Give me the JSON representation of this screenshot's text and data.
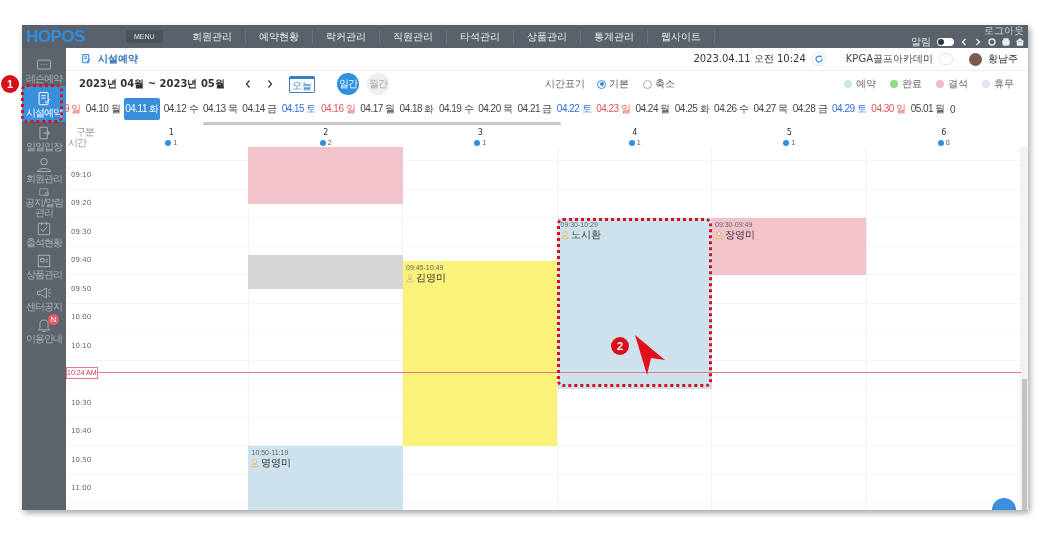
{
  "topbar": {
    "logo": "HOPOS",
    "menu_button": "MENU",
    "nav": [
      "회원관리",
      "예약현황",
      "락커관리",
      "직원관리",
      "타석관리",
      "상품관리",
      "통계관리",
      "웹사이트"
    ],
    "logout": "로그아웃",
    "alarm": {
      "label": "알림",
      "on": false
    }
  },
  "sidebar": {
    "items": [
      {
        "label": "레슨예약",
        "selected": false
      },
      {
        "label": "시설예약",
        "selected": true
      },
      {
        "label": "일일입장",
        "selected": false
      },
      {
        "label": "회원관리",
        "selected": false
      },
      {
        "label": "공지/알림관리",
        "selected": false
      },
      {
        "label": "출석현황",
        "selected": false
      },
      {
        "label": "상품관리",
        "selected": false
      },
      {
        "label": "센터공지",
        "selected": false
      },
      {
        "label": "이용안내",
        "selected": false,
        "badge": "N"
      }
    ]
  },
  "header": {
    "title": "시설예약",
    "datetime": "2023.04.11 오전 10:24",
    "center": "KPGA골프아카데미",
    "user": "황남주"
  },
  "toolbar": {
    "range": "2023년 04월 ~ 2023년 05월",
    "today": "오늘",
    "views": [
      {
        "label": "일간",
        "selected": true
      },
      {
        "label": "월간",
        "selected": false
      }
    ],
    "time_display": {
      "label": "시간표기",
      "options": [
        {
          "label": "기본",
          "selected": true
        },
        {
          "label": "축소",
          "selected": false
        }
      ]
    },
    "legend": [
      {
        "label": "예약",
        "color": "#cfe4ef"
      },
      {
        "label": "완료",
        "color": "#93d98c"
      },
      {
        "label": "결석",
        "color": "#f3b9c5"
      },
      {
        "label": "휴무",
        "color": "#e6e3f3"
      }
    ]
  },
  "dates": [
    {
      "label": "9 일",
      "kind": "sun",
      "selected": false
    },
    {
      "label": "04.10 월",
      "kind": "weekday",
      "selected": false
    },
    {
      "label": "04.11 화",
      "kind": "weekday",
      "selected": true
    },
    {
      "label": "04.12 수",
      "kind": "weekday",
      "selected": false
    },
    {
      "label": "04.13 목",
      "kind": "weekday",
      "selected": false
    },
    {
      "label": "04.14 금",
      "kind": "weekday",
      "selected": false
    },
    {
      "label": "04.15 토",
      "kind": "sat",
      "selected": false
    },
    {
      "label": "04.16 일",
      "kind": "sun",
      "selected": false
    },
    {
      "label": "04.17 월",
      "kind": "weekday",
      "selected": false
    },
    {
      "label": "04.18 화",
      "kind": "weekday",
      "selected": false
    },
    {
      "label": "04.19 수",
      "kind": "weekday",
      "selected": false
    },
    {
      "label": "04.20 목",
      "kind": "weekday",
      "selected": false
    },
    {
      "label": "04.21 금",
      "kind": "weekday",
      "selected": false
    },
    {
      "label": "04.22 토",
      "kind": "sat",
      "selected": false
    },
    {
      "label": "04.23 일",
      "kind": "sun",
      "selected": false
    },
    {
      "label": "04.24 월",
      "kind": "weekday",
      "selected": false
    },
    {
      "label": "04.25 화",
      "kind": "weekday",
      "selected": false
    },
    {
      "label": "04.26 수",
      "kind": "weekday",
      "selected": false
    },
    {
      "label": "04.27 목",
      "kind": "weekday",
      "selected": false
    },
    {
      "label": "04.28 금",
      "kind": "weekday",
      "selected": false
    },
    {
      "label": "04.29 토",
      "kind": "sat",
      "selected": false
    },
    {
      "label": "04.30 일",
      "kind": "sun",
      "selected": false
    },
    {
      "label": "05.01 월",
      "kind": "weekday",
      "selected": false
    },
    {
      "label": "0",
      "kind": "weekday",
      "selected": false
    }
  ],
  "axis": {
    "top": "구분",
    "side": "시간"
  },
  "columns": [
    {
      "name": "1",
      "count": "1"
    },
    {
      "name": "2",
      "count": "2",
      "reservations": [
        {
          "color": "#f3c3cb"
        },
        {
          "color": "#d6d6d6"
        },
        {
          "color": "#cde2ec",
          "time": "10:50-11:19",
          "name": "명영미"
        }
      ]
    },
    {
      "name": "3",
      "count": "1",
      "reservations": [
        {
          "color": "#fbf27a",
          "time": "09:45-10:49",
          "name": "김영미"
        }
      ]
    },
    {
      "name": "4",
      "count": "1",
      "reservations": [
        {
          "color": "#cde2ec",
          "time": "09:30-10:29",
          "name": "노시환"
        }
      ]
    },
    {
      "name": "5",
      "count": "1",
      "reservations": [
        {
          "color": "#f3c3cb",
          "time": "09:30-09:49",
          "name": "장영미"
        }
      ]
    },
    {
      "name": "6",
      "count": "0"
    }
  ],
  "time_rows": [
    "09:10",
    "09:20",
    "09:30",
    "09:40",
    "09:50",
    "10:00",
    "10:10",
    "10:30",
    "10:40",
    "10:50",
    "11:00"
  ],
  "now": {
    "label": "10:24 AM"
  },
  "callouts": [
    {
      "number": "1"
    },
    {
      "number": "2"
    }
  ]
}
